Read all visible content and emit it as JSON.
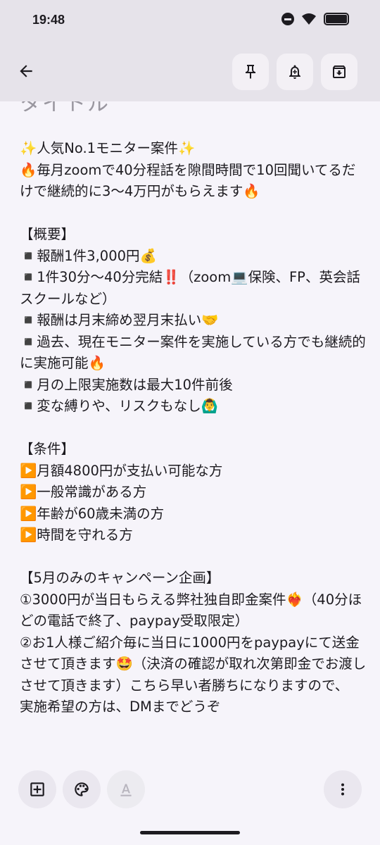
{
  "status_bar": {
    "time": "19:48"
  },
  "toolbar": {
    "back_icon": "arrow-back-icon",
    "pin_icon": "pin-icon",
    "reminder_icon": "bell-plus-icon",
    "archive_icon": "archive-icon"
  },
  "note": {
    "title_placeholder": "タイトル",
    "body": "✨人気No.1モニター案件✨\n🔥毎月zoomで40分程話を隙間時間で10回聞いてるだけで継続的に3〜4万円がもらえます🔥\n\n【概要】\n◾️報酬1件3,000円💰\n◾️1件30分〜40分完結‼️（zoom💻保険、FP、英会話スクールなど）\n◾️報酬は月末締め翌月末払い🤝\n◾️過去、現在モニター案件を実施している方でも継続的に実施可能🔥\n◾️月の上限実施数は最大10件前後\n◾️変な縛りや、リスクもなし🙆‍♂️\n\n【条件】\n▶️月額4800円が支払い可能な方\n▶️一般常識がある方\n▶️年齢が60歳未満の方\n▶️時間を守れる方\n\n【5月のみのキャンペーン企画】\n①3000円が当日もらえる弊社独自即金案件❤️‍🔥（40分ほどの電話で終了、paypay受取限定）\n②お1人様ご紹介毎に当日に1000円をpaypayにて送金させて頂きます🤩（決済の確認が取れ次第即金でお渡しさせて頂きます）こちら早い者勝ちになりますので、\n実施希望の方は、DMまでどうぞ"
  },
  "bottom_bar": {
    "add_icon": "add-box-icon",
    "palette_icon": "palette-icon",
    "text_format_icon": "text-format-icon",
    "more_icon": "more-vert-icon"
  },
  "colors": {
    "background": "#f6f4fa",
    "toolbar_bg": "#e6e3ea",
    "text": "#1d1b20"
  }
}
